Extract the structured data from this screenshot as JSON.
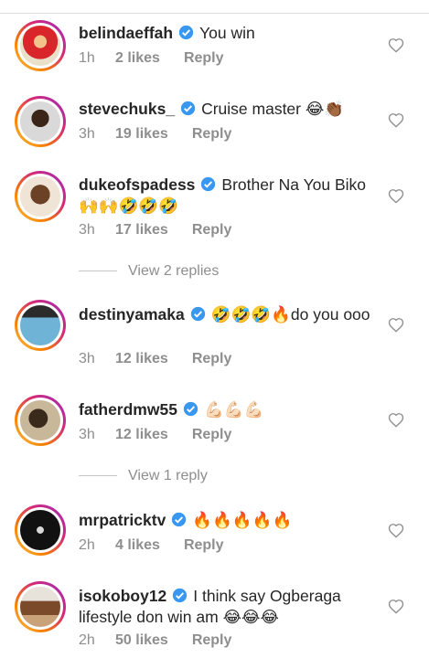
{
  "comments": [
    {
      "username": "belindaeffah",
      "text": "You win",
      "time": "1h",
      "likes": "2 likes",
      "reply": "Reply"
    },
    {
      "username": "stevechuks_",
      "text": "Cruise master 😂👏🏾",
      "time": "3h",
      "likes": "19 likes",
      "reply": "Reply"
    },
    {
      "username": "dukeofspadess",
      "text": "Brother Na You Biko 🙌🙌🤣🤣🤣",
      "time": "3h",
      "likes": "17 likes",
      "reply": "Reply",
      "view_replies": "View 2 replies"
    },
    {
      "username": "destinyamaka",
      "text": "🤣🤣🤣🔥do you ooo",
      "time": "3h",
      "likes": "12 likes",
      "reply": "Reply"
    },
    {
      "username": "fatherdmw55",
      "text": "💪🏻💪🏻💪🏻",
      "time": "3h",
      "likes": "12 likes",
      "reply": "Reply",
      "view_replies": "View 1 reply"
    },
    {
      "username": "mrpatricktv",
      "text": "🔥🔥🔥🔥🔥",
      "time": "2h",
      "likes": "4 likes",
      "reply": "Reply"
    },
    {
      "username": "isokoboy12",
      "text": "I think say Ogberaga lifestyle don win am 😂😂😂",
      "time": "2h",
      "likes": "50 likes",
      "reply": "Reply"
    }
  ],
  "icons": {
    "verified": "verified-badge-icon",
    "like": "heart-outline-icon"
  },
  "colors": {
    "verified_blue": "#3897f0",
    "meta_gray": "#8e8e8e",
    "text": "#262626"
  }
}
